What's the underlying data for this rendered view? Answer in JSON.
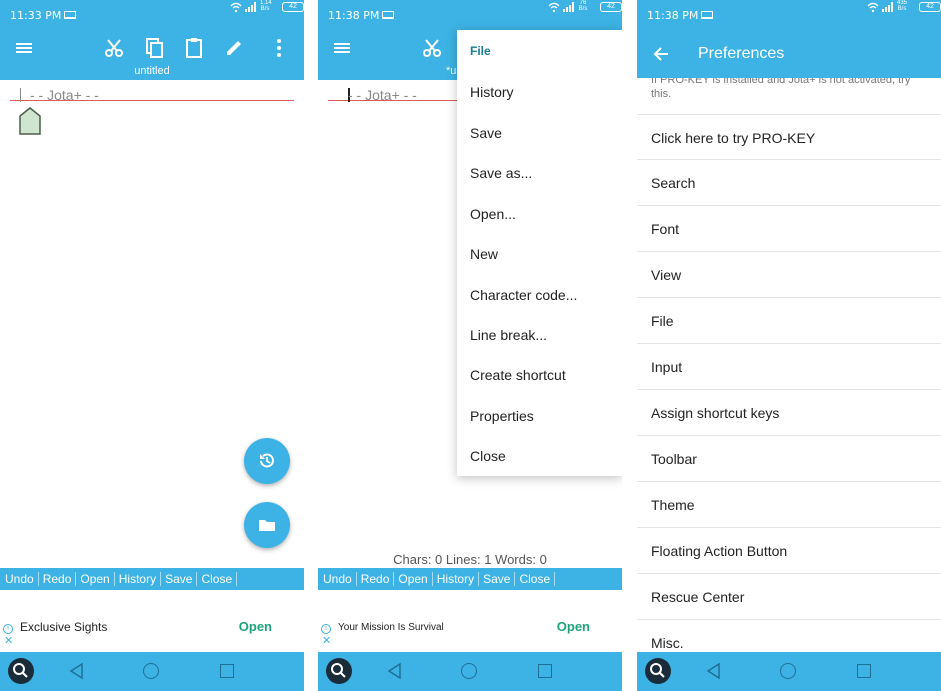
{
  "status": {
    "screen1_time": "11:33 PM",
    "screen2_time": "11:38 PM",
    "screen3_time": "11:38 PM",
    "battery": "42",
    "speed1": "1.14 B/s",
    "speed2": "76 B/s",
    "speed3": "435 B/s"
  },
  "editor": {
    "doc_title": "untitled",
    "doc_title_modified": "*u",
    "line_text": "- - Jota+ - -",
    "counts": "Chars: 0  Lines: 1  Words: 0"
  },
  "bottom_bar": [
    "Undo",
    "Redo",
    "Open",
    "History",
    "Save",
    "Close"
  ],
  "ads": {
    "ad1_title": "Exclusive Sights",
    "ad2_title": "Your Mission Is Survival",
    "open_label": "Open",
    "info_glyph": "i",
    "close_glyph": "✕"
  },
  "file_menu": {
    "header": "File",
    "items": [
      "History",
      "Save",
      "Save as...",
      "Open...",
      "New",
      "Character code...",
      "Line break...",
      "Create shortcut",
      "Properties",
      "Close"
    ]
  },
  "preferences": {
    "title": "Preferences",
    "note": "If PRO-KEY is installed and Jota+ is not activated, try this.",
    "items": [
      "Click here to try PRO-KEY",
      "Search",
      "Font",
      "View",
      "File",
      "Input",
      "Assign shortcut keys",
      "Toolbar",
      "Theme",
      "Floating Action Button",
      "Rescue Center",
      "Misc."
    ]
  },
  "icons": {
    "menu": "hamburger-icon",
    "cut": "scissors-icon",
    "copy": "copy-icon",
    "paste": "clipboard-icon",
    "edit": "pencil-icon",
    "more": "more-vert-icon",
    "history_fab": "history-icon",
    "folder_fab": "folder-icon",
    "back": "arrow-back-icon"
  },
  "colors": {
    "primary": "#3cb3e4",
    "accent_text": "#177d93",
    "ad_open": "#1da37c"
  }
}
